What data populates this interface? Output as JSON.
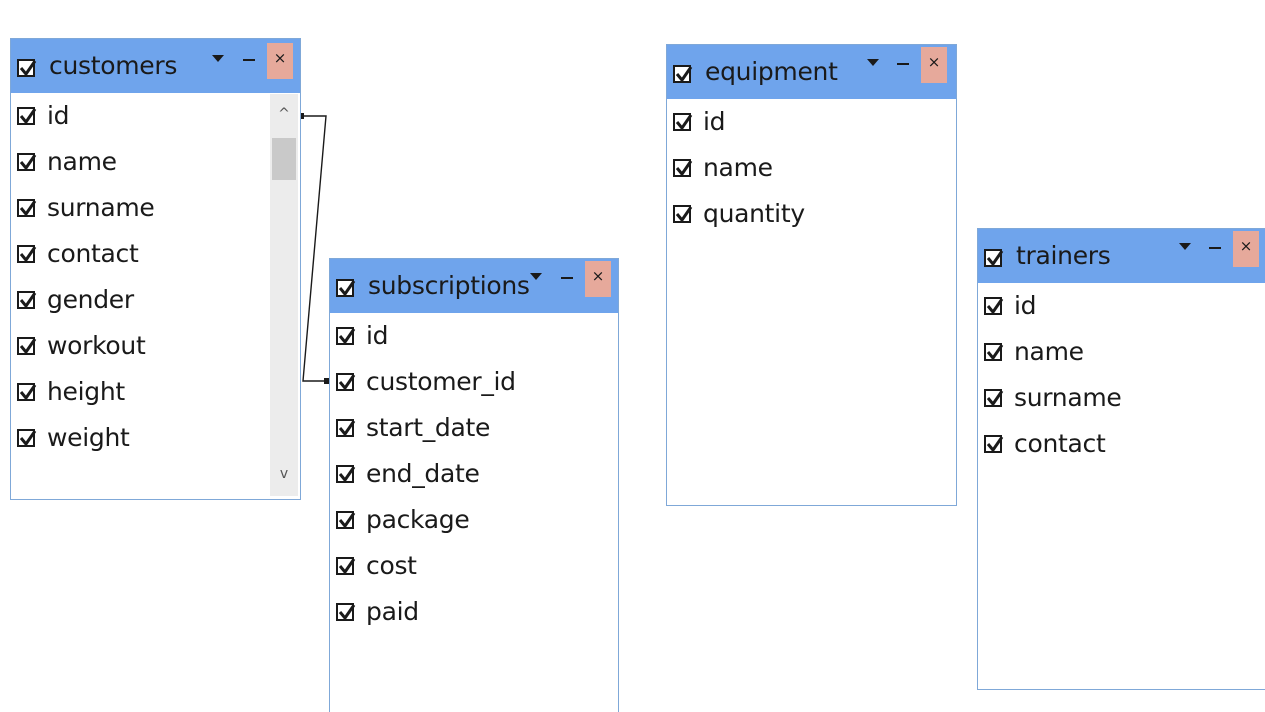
{
  "tables": {
    "customers": {
      "title": "customers",
      "close_glyph": "×",
      "fields": [
        "id",
        "name",
        "surname",
        "contact",
        "gender",
        "workout",
        "height",
        "weight"
      ]
    },
    "subscriptions": {
      "title": "subscriptions",
      "close_glyph": "×",
      "fields": [
        "id",
        "customer_id",
        "start_date",
        "end_date",
        "package",
        "cost",
        "paid"
      ]
    },
    "equipment": {
      "title": "equipment",
      "close_glyph": "×",
      "fields": [
        "id",
        "name",
        "quantity"
      ]
    },
    "trainers": {
      "title": "trainers",
      "close_glyph": "×",
      "fields": [
        "id",
        "name",
        "surname",
        "contact"
      ]
    }
  },
  "scrollbar": {
    "up_glyph": "^",
    "down_glyph": "v"
  },
  "relationships": [
    {
      "from": "customers.id",
      "to": "subscriptions.customer_id"
    }
  ],
  "colors": {
    "title_bar": "#6fa4ec",
    "border": "#7fa8d8",
    "close_button": "#e6a99b"
  }
}
